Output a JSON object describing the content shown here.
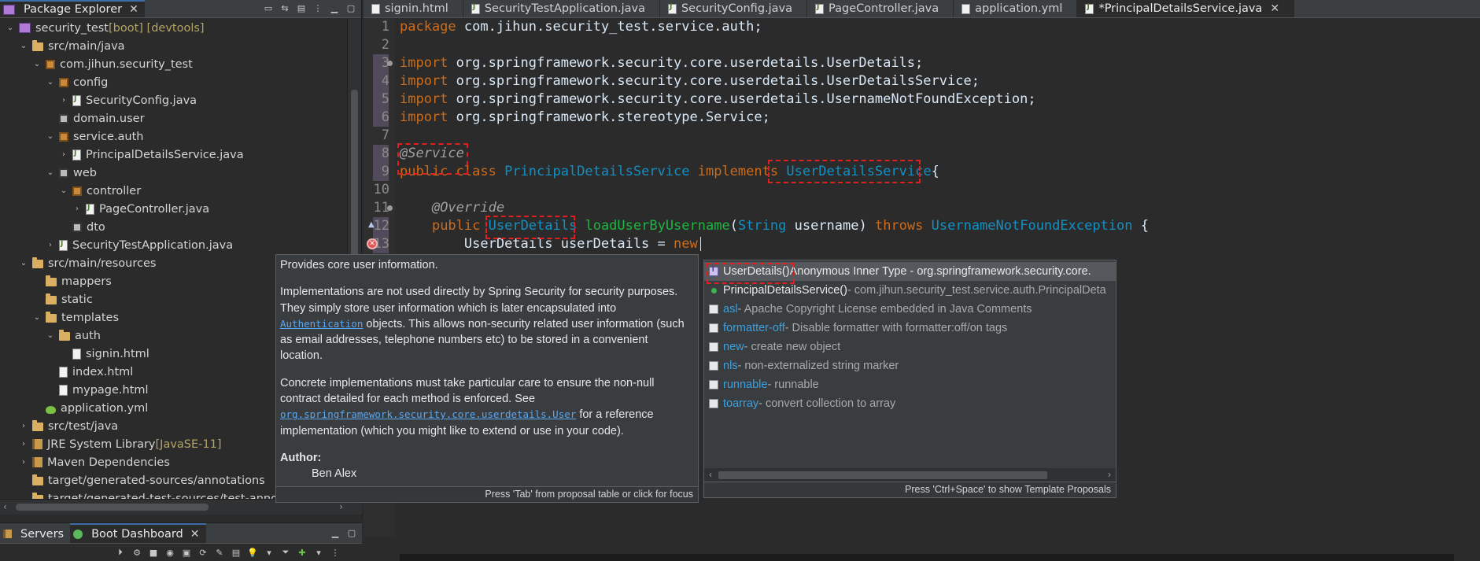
{
  "explorer": {
    "tab_label": "Package Explorer",
    "tree": [
      {
        "label": "security_test",
        "deco": " [boot] [devtools]",
        "icon": "project-icon",
        "depth": 0,
        "chev": "v"
      },
      {
        "label": "src/main/java",
        "icon": "folder-icon",
        "depth": 1,
        "chev": "v"
      },
      {
        "label": "com.jihun.security_test",
        "icon": "package-icon",
        "depth": 2,
        "chev": "v"
      },
      {
        "label": "config",
        "icon": "package-icon",
        "depth": 3,
        "chev": "v"
      },
      {
        "label": "SecurityConfig.java",
        "icon": "java-file-icon",
        "depth": 4,
        "chev": ">"
      },
      {
        "label": "domain.user",
        "icon": "empty-package-icon",
        "depth": 3,
        "chev": ""
      },
      {
        "label": "service.auth",
        "icon": "package-icon",
        "depth": 3,
        "chev": "v"
      },
      {
        "label": "PrincipalDetailsService.java",
        "icon": "java-file-icon",
        "depth": 4,
        "chev": ">"
      },
      {
        "label": "web",
        "icon": "empty-package-icon",
        "depth": 3,
        "chev": "v"
      },
      {
        "label": "controller",
        "icon": "package-icon",
        "depth": 4,
        "chev": "v"
      },
      {
        "label": "PageController.java",
        "icon": "java-file-icon",
        "depth": 5,
        "chev": ">"
      },
      {
        "label": "dto",
        "icon": "empty-package-icon",
        "depth": 4,
        "chev": ""
      },
      {
        "label": "SecurityTestApplication.java",
        "icon": "java-file-icon",
        "depth": 3,
        "chev": ">"
      },
      {
        "label": "src/main/resources",
        "icon": "folder-icon",
        "depth": 1,
        "chev": "v"
      },
      {
        "label": "mappers",
        "icon": "folder-icon",
        "depth": 2,
        "chev": ""
      },
      {
        "label": "static",
        "icon": "folder-icon",
        "depth": 2,
        "chev": ""
      },
      {
        "label": "templates",
        "icon": "folder-icon",
        "depth": 2,
        "chev": "v"
      },
      {
        "label": "auth",
        "icon": "folder-icon",
        "depth": 3,
        "chev": "v"
      },
      {
        "label": "signin.html",
        "icon": "file-icon",
        "depth": 4,
        "chev": ""
      },
      {
        "label": "index.html",
        "icon": "file-icon",
        "depth": 3,
        "chev": ""
      },
      {
        "label": "mypage.html",
        "icon": "file-icon",
        "depth": 3,
        "chev": ""
      },
      {
        "label": "application.yml",
        "icon": "yml-file-icon",
        "depth": 2,
        "chev": ""
      },
      {
        "label": "src/test/java",
        "icon": "folder-icon",
        "depth": 1,
        "chev": ">"
      },
      {
        "label": "JRE System Library",
        "deco": " [JavaSE-11]",
        "icon": "library-icon",
        "depth": 1,
        "chev": ">"
      },
      {
        "label": "Maven Dependencies",
        "icon": "library-icon",
        "depth": 1,
        "chev": ">"
      },
      {
        "label": "target/generated-sources/annotations",
        "icon": "folder-icon",
        "depth": 1,
        "chev": ""
      },
      {
        "label": "target/generated-test-sources/test-annotat",
        "icon": "folder-icon",
        "depth": 1,
        "chev": ""
      }
    ]
  },
  "servers": {
    "tab_servers": "Servers",
    "tab_boot": "Boot Dashboard"
  },
  "editor": {
    "tabs": [
      {
        "label": "signin.html",
        "active": false
      },
      {
        "label": "SecurityTestApplication.java",
        "active": false
      },
      {
        "label": "SecurityConfig.java",
        "active": false
      },
      {
        "label": "PageController.java",
        "active": false
      },
      {
        "label": "application.yml",
        "active": false
      },
      {
        "label": "*PrincipalDetailsService.java",
        "active": true
      }
    ],
    "line_numbers": [
      "1",
      "2",
      "3",
      "4",
      "5",
      "6",
      "7",
      "8",
      "9",
      "10",
      "11",
      "12",
      "13"
    ],
    "code": {
      "l1_kw": "package",
      "l1_rest": " com.jihun.security_test.service.auth;",
      "l3_kw": "import",
      "l3_rest": " org.springframework.security.core.userdetails.UserDetails;",
      "l4_kw": "import",
      "l4_rest": " org.springframework.security.core.userdetails.UserDetailsService;",
      "l5_kw": "import",
      "l5_rest": " org.springframework.security.core.userdetails.UsernameNotFoundException;",
      "l6_kw": "import",
      "l6_rest": " org.springframework.stereotype.Service;",
      "l8_ann": "@Service",
      "l9_kw1": "public class",
      "l9_cls": "PrincipalDetailsService",
      "l9_kw2": "implements",
      "l9_iface": "UserDetailsService",
      "l9_brace": "{",
      "l11_ann": "@Override",
      "l12_kw": "public",
      "l12_type": "UserDetails",
      "l12_fn": "loadUserByUsername",
      "l12_open": "(",
      "l12_ptype": "String",
      "l12_param": " username) ",
      "l12_throws": "throws",
      "l12_ex": "UsernameNotFoundException",
      "l12_brace": " {",
      "l13_text": "UserDetails userDetails = ",
      "l13_kw": "new"
    }
  },
  "javadoc": {
    "p1": "Provides core user information.",
    "p2a": "Implementations are not used directly by Spring Security for security purposes. They simply store user information which is later encapsulated into ",
    "p2link": "Authentication",
    "p2b": " objects. This allows non-security related user information (such as email addresses, telephone numbers etc) to be stored in a convenient location.",
    "p3a": "Concrete implementations must take particular care to ensure the non-null contract detailed for each method is enforced. See ",
    "p3link": "org.springframework.security.core.userdetails.User",
    "p3b": " for a reference implementation (which you might like to extend or use in your code).",
    "author_label": "Author:",
    "author_name": "Ben Alex",
    "footer": "Press 'Tab' from proposal table or click for focus"
  },
  "proposals": {
    "items": [
      {
        "name": "UserDetails()",
        "desc": " Anonymous Inner Type - org.springframework.security.core.",
        "icon": "class-icon",
        "kind": "cls"
      },
      {
        "name": "PrincipalDetailsService()",
        "desc": " - com.jihun.security_test.service.auth.PrincipalDeta",
        "icon": "constructor-icon",
        "kind": "ctor"
      },
      {
        "name": "asl",
        "desc": " - Apache Copyright License embedded in Java Comments",
        "icon": "template-icon",
        "kind": "tpl"
      },
      {
        "name": "formatter-off",
        "desc": " - Disable formatter with formatter:off/on tags",
        "icon": "template-icon",
        "kind": "tpl"
      },
      {
        "name": "new",
        "desc": " - create new object",
        "icon": "template-icon",
        "kind": "tpl"
      },
      {
        "name": "nls",
        "desc": " - non-externalized string marker",
        "icon": "template-icon",
        "kind": "tpl"
      },
      {
        "name": "runnable",
        "desc": " - runnable",
        "icon": "template-icon",
        "kind": "tpl"
      },
      {
        "name": "toarray",
        "desc": " - convert collection to array",
        "icon": "template-icon",
        "kind": "tpl"
      }
    ],
    "footer": "Press 'Ctrl+Space' to show Template Proposals"
  }
}
